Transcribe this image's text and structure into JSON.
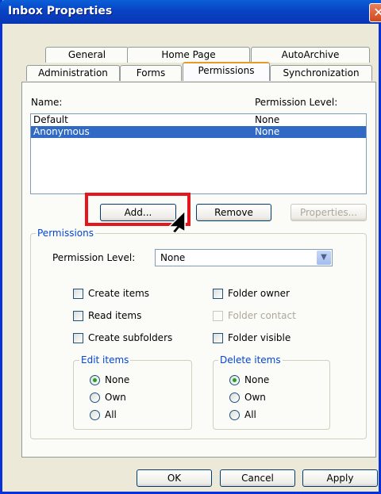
{
  "window": {
    "title": "Inbox Properties",
    "close_glyph": "✕"
  },
  "tabs": {
    "row_back": [
      "General",
      "Home Page",
      "AutoArchive"
    ],
    "row_front": [
      "Administration",
      "Forms",
      "Permissions",
      "Synchronization"
    ],
    "active": "Permissions"
  },
  "permissions_list": {
    "name_header": "Name:",
    "level_header": "Permission Level:",
    "rows": [
      {
        "name": "Default",
        "level": "None",
        "selected": false
      },
      {
        "name": "Anonymous",
        "level": "None",
        "selected": true
      }
    ]
  },
  "list_buttons": {
    "add": "Add...",
    "remove": "Remove",
    "properties": "Properties..."
  },
  "permissions_group": {
    "legend": "Permissions",
    "level_label": "Permission Level:",
    "level_value": "None",
    "checkboxes": [
      {
        "label": "Create items",
        "checked": false,
        "enabled": true
      },
      {
        "label": "Read items",
        "checked": false,
        "enabled": true
      },
      {
        "label": "Create subfolders",
        "checked": false,
        "enabled": true
      },
      {
        "label": "Folder owner",
        "checked": false,
        "enabled": true
      },
      {
        "label": "Folder contact",
        "checked": false,
        "enabled": false
      },
      {
        "label": "Folder visible",
        "checked": false,
        "enabled": true
      }
    ],
    "edit_items": {
      "legend": "Edit items",
      "options": [
        "None",
        "Own",
        "All"
      ],
      "selected": "None"
    },
    "delete_items": {
      "legend": "Delete items",
      "options": [
        "None",
        "Own",
        "All"
      ],
      "selected": "None"
    }
  },
  "dialog_buttons": {
    "ok": "OK",
    "cancel": "Cancel",
    "apply": "Apply"
  },
  "colors": {
    "highlight": "#e4151c",
    "selection": "#316ac5",
    "title_bar": "#0843c4"
  }
}
